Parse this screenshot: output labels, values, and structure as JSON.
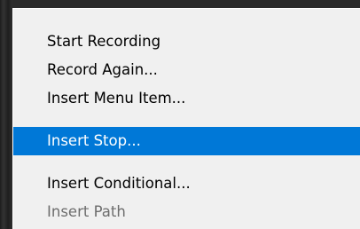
{
  "menu": {
    "items": [
      {
        "label": "Start Recording",
        "state": "normal"
      },
      {
        "label": "Record Again...",
        "state": "normal"
      },
      {
        "label": "Insert Menu Item...",
        "state": "normal"
      },
      {
        "label": "Insert Stop...",
        "state": "highlighted"
      },
      {
        "label": "Insert Conditional...",
        "state": "normal"
      },
      {
        "label": "Insert Path",
        "state": "disabled"
      }
    ]
  },
  "colors": {
    "menu_background": "#f0f0f0",
    "highlight": "#0078d7",
    "highlight_text": "#ffffff",
    "disabled_text": "#6d6d6d",
    "backdrop": "#2a2a2a"
  }
}
